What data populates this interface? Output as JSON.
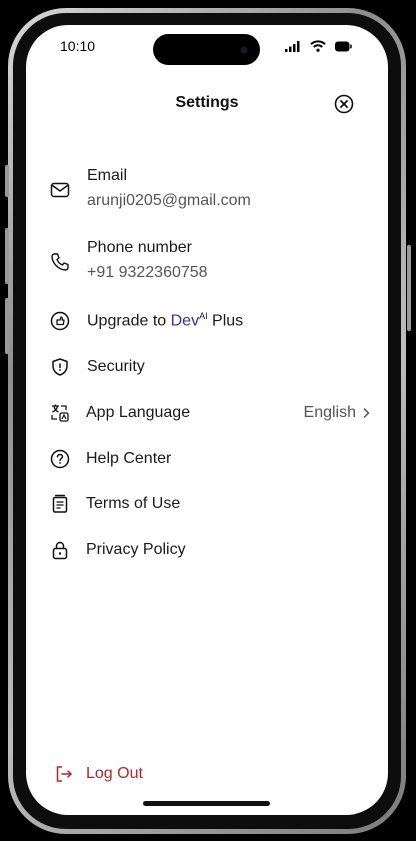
{
  "status_bar": {
    "time": "10:10"
  },
  "header": {
    "title": "Settings"
  },
  "account": {
    "email_label": "Email",
    "email_value": "arunji0205@gmail.com",
    "phone_label": "Phone number",
    "phone_value": "+91 9322360758"
  },
  "menu": {
    "upgrade": {
      "prefix": "Upgrade to ",
      "brand": "Dev",
      "brand_sup": "AI",
      "suffix": " Plus"
    },
    "security": "Security",
    "app_language": "App Language",
    "app_language_value": "English",
    "help_center": "Help Center",
    "terms": "Terms of Use",
    "privacy": "Privacy Policy"
  },
  "footer": {
    "logout": "Log Out"
  },
  "colors": {
    "logout": "#b3262d",
    "brand": "#3a2d9c"
  }
}
